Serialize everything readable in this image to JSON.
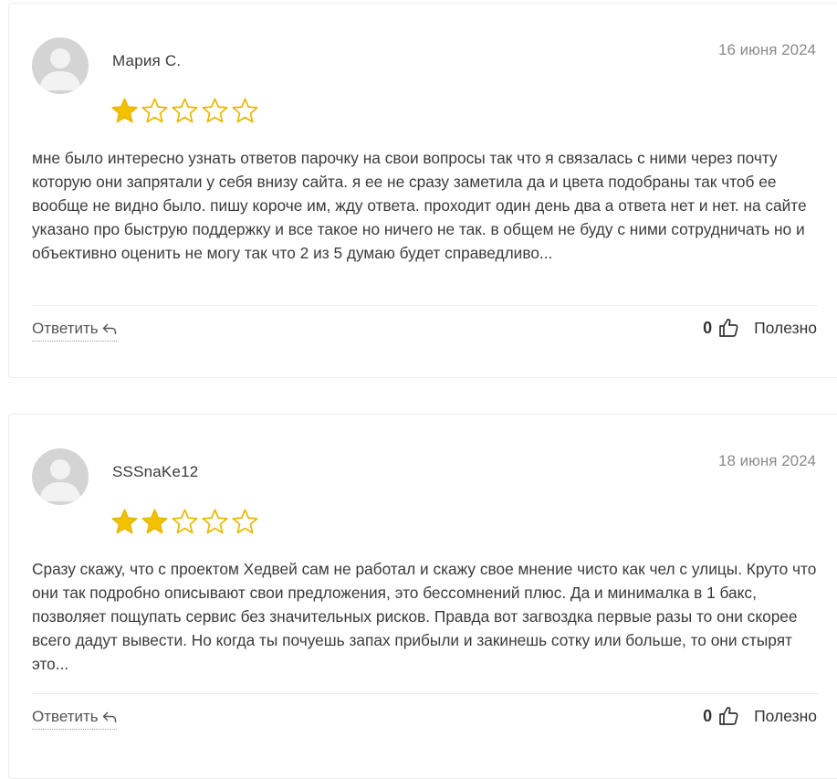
{
  "reviews": [
    {
      "author": "Мария С.",
      "date": "16 июня 2024",
      "rating": 1,
      "rating_max": 5,
      "text": "мне было интересно узнать ответов парочку на свои вопросы так что я связалась с ними через почту которую они запрятали у себя внизу сайта. я ее не сразу заметила да и цвета подобраны так чтоб ее вообще не видно было. пишу короче им, жду ответа. проходит один день два а ответа нет и нет. на сайте указано про быструю поддержку и все такое но ничего не так. в общем не буду с ними сотрудничать но и объективно оценить не могу так что 2 из 5 думаю будет справедливо...",
      "reply_label": "Ответить",
      "likes": "0",
      "helpful_label": "Полезно"
    },
    {
      "author": "SSSnaKe12",
      "date": "18 июня 2024",
      "rating": 2,
      "rating_max": 5,
      "text": "Сразу скажу, что с проектом Хедвей сам не работал и скажу свое мнение чисто как чел с улицы. Круто что они так подробно описывают свои предложения, это бессомнений плюс. Да и минималка в 1 бакс, позволяет пощупать сервис без значительных рисков. Правда вот загвоздка первые разы то они скорее всего дадут вывести. Но когда ты почуешь запах прибыли и закинешь сотку или больше, то они стырят это...",
      "reply_label": "Ответить",
      "likes": "0",
      "helpful_label": "Полезно"
    }
  ],
  "colors": {
    "star_filled": "#f2c200",
    "star_outline": "#e8b800",
    "avatar_bg": "#d4d4d4",
    "avatar_fg": "#f2f2f2"
  },
  "icons": {
    "star": "star-icon",
    "reply": "reply-arrow-icon",
    "like": "thumbs-up-icon",
    "avatar": "default-user-avatar"
  }
}
